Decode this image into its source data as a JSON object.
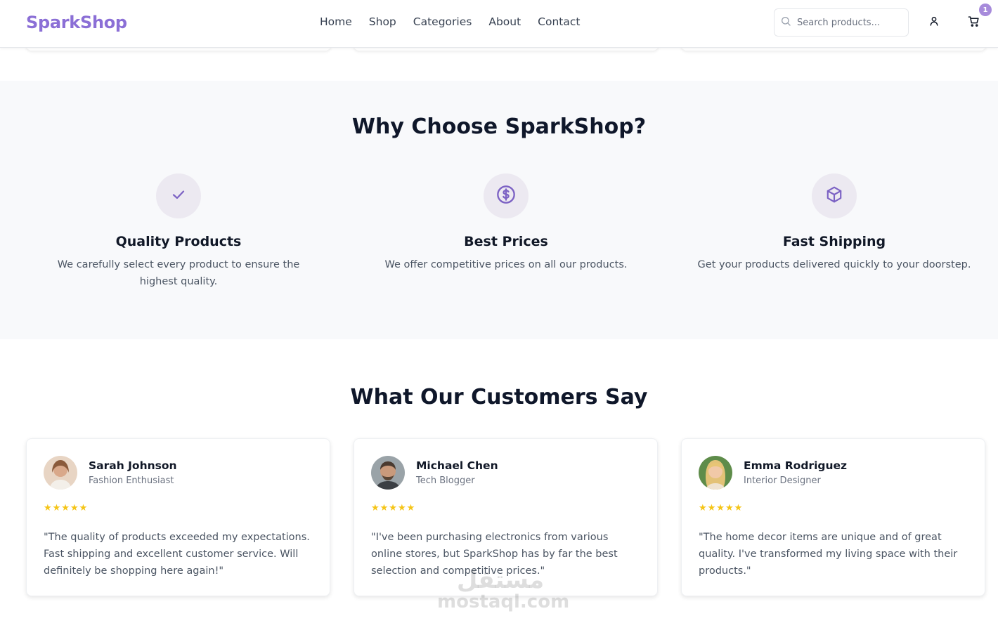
{
  "header": {
    "logo": "SparkShop",
    "nav": [
      "Home",
      "Shop",
      "Categories",
      "About",
      "Contact"
    ],
    "search_placeholder": "Search products...",
    "cart_count": "1"
  },
  "why": {
    "title": "Why Choose SparkShop?",
    "features": [
      {
        "icon": "check-icon",
        "title": "Quality Products",
        "text": "We carefully select every product to ensure the highest quality."
      },
      {
        "icon": "dollar-icon",
        "title": "Best Prices",
        "text": "We offer competitive prices on all our products."
      },
      {
        "icon": "box-icon",
        "title": "Fast Shipping",
        "text": "Get your products delivered quickly to your doorstep."
      }
    ]
  },
  "testimonials": {
    "title": "What Our Customers Say",
    "items": [
      {
        "name": "Sarah Johnson",
        "role": "Fashion Enthusiast",
        "stars": "★★★★★",
        "quote": "\"The quality of products exceeded my expectations. Fast shipping and excellent customer service. Will definitely be shopping here again!\""
      },
      {
        "name": "Michael Chen",
        "role": "Tech Blogger",
        "stars": "★★★★★",
        "quote": "\"I've been purchasing electronics from various online stores, but SparkShop has by far the best selection and competitive prices.\""
      },
      {
        "name": "Emma Rodriguez",
        "role": "Interior Designer",
        "stars": "★★★★★",
        "quote": "\"The home decor items are unique and of great quality. I've transformed my living space with their products.\""
      }
    ]
  },
  "watermark": {
    "arabic": "مستقل",
    "latin": "mostaql.com"
  },
  "colors": {
    "brand": "#8b6fd6",
    "accent_icon": "#7c62c4",
    "star": "#f5c518",
    "section_bg": "#f8f9fb"
  }
}
